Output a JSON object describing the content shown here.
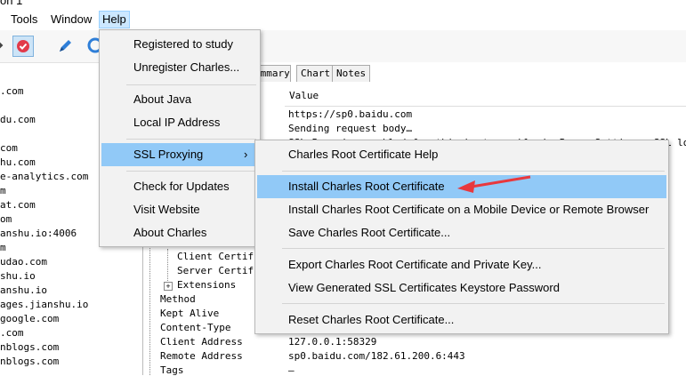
{
  "window": {
    "title_fragment": "on 1"
  },
  "menubar": {
    "items": [
      "Tools",
      "Window",
      "Help"
    ],
    "active": "Help"
  },
  "left_tree": {
    "items": [
      ".com",
      "du.com",
      "com",
      "hu.com",
      "e-analytics.com",
      "m",
      "at.com",
      "om",
      "anshu.io:4006",
      "m",
      "udao.com",
      "shu.io",
      "anshu.io",
      "ages.jianshu.io",
      "google.com",
      ".com",
      "nblogs.com",
      "nblogs.com"
    ]
  },
  "tabs": [
    "ummary",
    "Chart",
    "Notes"
  ],
  "table": {
    "value_header": "Value",
    "values": [
      "https://sp0.baidu.com",
      "Sending request body…",
      "SSL Proxying enabled for this host: enable in Proxy Settings, SSL locat"
    ],
    "bottom_values": [
      "127.0.0.1:58329",
      "sp0.baidu.com/182.61.200.6:443",
      "–"
    ]
  },
  "properties": {
    "items": [
      "Client Certifi",
      "Server Certifi",
      "Extensions",
      "Method",
      "Kept Alive",
      "Content-Type",
      "Client Address",
      "Remote Address",
      "Tags"
    ]
  },
  "help_menu": {
    "items": [
      "Registered to study",
      "Unregister Charles...",
      "About Java",
      "Local IP Address",
      "SSL Proxying",
      "Check for Updates",
      "Visit Website",
      "About Charles"
    ],
    "submenu_arrow": "›"
  },
  "ssl_submenu": {
    "items": [
      "Charles Root Certificate Help",
      "Install Charles Root Certificate",
      "Install Charles Root Certificate on a Mobile Device or Remote Browser",
      "Save Charles Root Certificate...",
      "Export Charles Root Certificate and Private Key...",
      "View Generated SSL Certificates Keystore Password",
      "Reset Charles Root Certificate..."
    ],
    "highlighted": "Install Charles Root Certificate"
  },
  "colors": {
    "highlight": "#91c9f7",
    "menu_bg": "#f2f2f2",
    "arrow": "#e8383d"
  },
  "icons": [
    "pen-icon",
    "stop-icon",
    "circle-icon"
  ]
}
